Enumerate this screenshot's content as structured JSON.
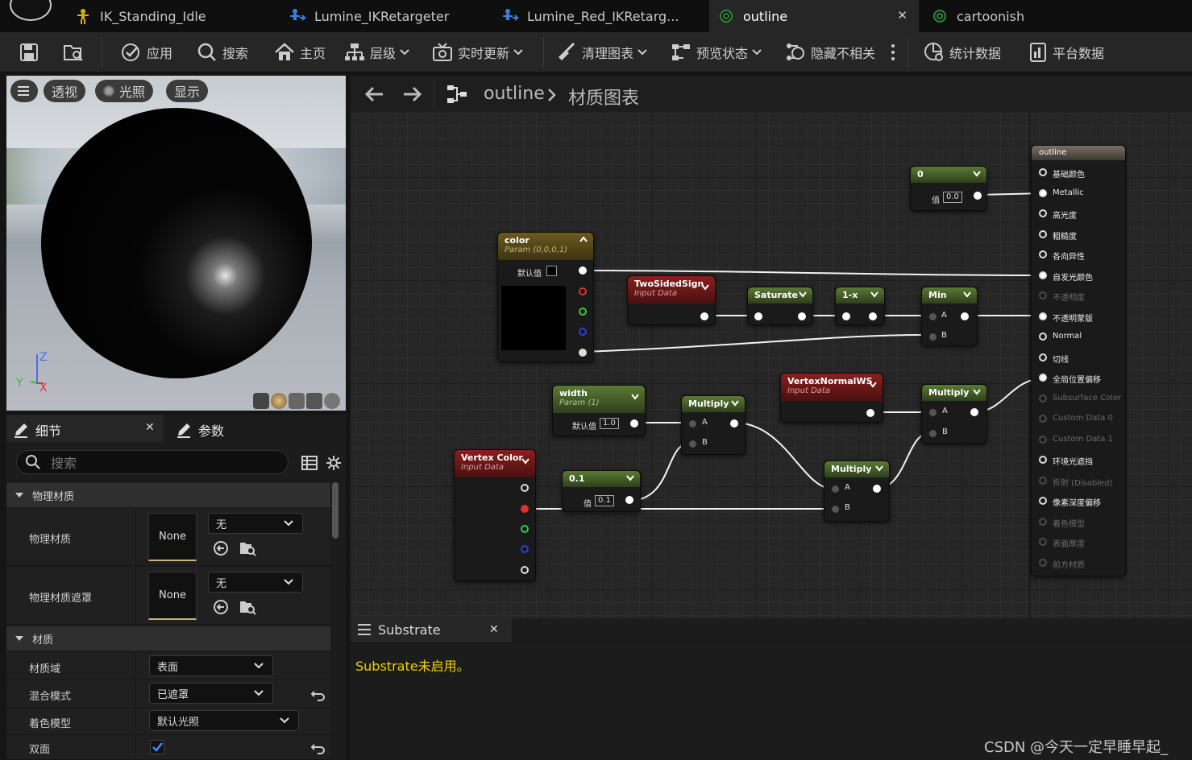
{
  "tabs": [
    {
      "label": "IK_Standing_Idle",
      "icon": "skeleton-icon",
      "active": false
    },
    {
      "label": "Lumine_IKRetargeter",
      "icon": "retarget-icon",
      "active": false
    },
    {
      "label": "Lumine_Red_IKRetarg...",
      "icon": "retarget-icon",
      "active": false
    },
    {
      "label": "outline",
      "icon": "material-icon",
      "active": true
    },
    {
      "label": "cartoonish",
      "icon": "material-icon",
      "active": false
    }
  ],
  "toolbar": {
    "apply": "应用",
    "search": "搜索",
    "home": "主页",
    "hierarchy": "层级",
    "live_update": "实时更新",
    "clean_graph": "清理图表",
    "preview_state": "预览状态",
    "hide_unrelated": "隐藏不相关",
    "stats": "统计数据",
    "platform_stats": "平台数据"
  },
  "viewport": {
    "perspective": "透视",
    "lit": "光照",
    "show": "显示",
    "axis_z": "Z",
    "axis_x": "X",
    "axis_y": "Y"
  },
  "details": {
    "tab_details": "细节",
    "tab_params": "参数",
    "search_placeholder": "搜索",
    "section_physical": "物理材质",
    "row_phys_mat": "物理材质",
    "row_phys_mask": "物理材质遮罩",
    "none_label": "None",
    "none_dropdown": "无",
    "section_material": "材质",
    "row_domain": "材质域",
    "domain_val": "表面",
    "row_blend": "混合模式",
    "blend_val": "已遮罩",
    "row_shading": "着色模型",
    "shading_val": "默认光照",
    "row_twosided": "双面",
    "twosided_checked": true
  },
  "graph": {
    "breadcrumb_asset": "outline",
    "breadcrumb_graph": "材质图表",
    "nodes": {
      "const0": {
        "title": "0",
        "value_label": "值",
        "value": "0.0"
      },
      "color": {
        "title": "color",
        "subtitle": "Param (0,0,0,1)",
        "default_label": "默认值"
      },
      "twosided": {
        "title": "TwoSidedSign",
        "subtitle": "Input Data"
      },
      "saturate": {
        "title": "Saturate"
      },
      "oneminus": {
        "title": "1-x"
      },
      "min": {
        "title": "Min",
        "a": "A",
        "b": "B"
      },
      "width": {
        "title": "width",
        "subtitle": "Param (1)",
        "default_label": "默认值",
        "value": "1.0"
      },
      "mult1": {
        "title": "Multiply",
        "a": "A",
        "b": "B"
      },
      "vertnormal": {
        "title": "VertexNormalWS",
        "subtitle": "Input Data"
      },
      "mult3": {
        "title": "Multiply",
        "a": "A",
        "b": "B"
      },
      "vertcolor": {
        "title": "Vertex Color",
        "subtitle": "Input Data"
      },
      "const01": {
        "title": "0.1",
        "value_label": "值",
        "value": "0.1"
      },
      "mult2": {
        "title": "Multiply",
        "a": "A",
        "b": "B"
      }
    },
    "output_node": {
      "title": "outline",
      "inputs": [
        {
          "label": "基础颜色",
          "enabled": true
        },
        {
          "label": "Metallic",
          "enabled": true
        },
        {
          "label": "高光度",
          "enabled": true
        },
        {
          "label": "粗糙度",
          "enabled": true
        },
        {
          "label": "各向异性",
          "enabled": true
        },
        {
          "label": "自发光颜色",
          "enabled": true
        },
        {
          "label": "不透明度",
          "enabled": false
        },
        {
          "label": "不透明蒙版",
          "enabled": true
        },
        {
          "label": "Normal",
          "enabled": true
        },
        {
          "label": "切线",
          "enabled": true
        },
        {
          "label": "全局位置偏移",
          "enabled": true
        },
        {
          "label": "Subsurface Color",
          "enabled": false
        },
        {
          "label": "Custom Data 0",
          "enabled": false
        },
        {
          "label": "Custom Data 1",
          "enabled": false
        },
        {
          "label": "环境光遮挡",
          "enabled": true
        },
        {
          "label": "折射 (Disabled)",
          "enabled": false
        },
        {
          "label": "像素深度偏移",
          "enabled": true
        },
        {
          "label": "着色模型",
          "enabled": false
        },
        {
          "label": "表面厚度",
          "enabled": false
        },
        {
          "label": "前方材质",
          "enabled": false
        }
      ]
    }
  },
  "substrate": {
    "tab": "Substrate",
    "message": "Substrate未启用。"
  },
  "watermark": "CSDN @今天一定早睡早起_",
  "colors": {
    "accent_yellow": "#f0d000",
    "tab_active": "#262626",
    "green_node": "#5a7a33",
    "red_node": "#8a1f1f"
  }
}
